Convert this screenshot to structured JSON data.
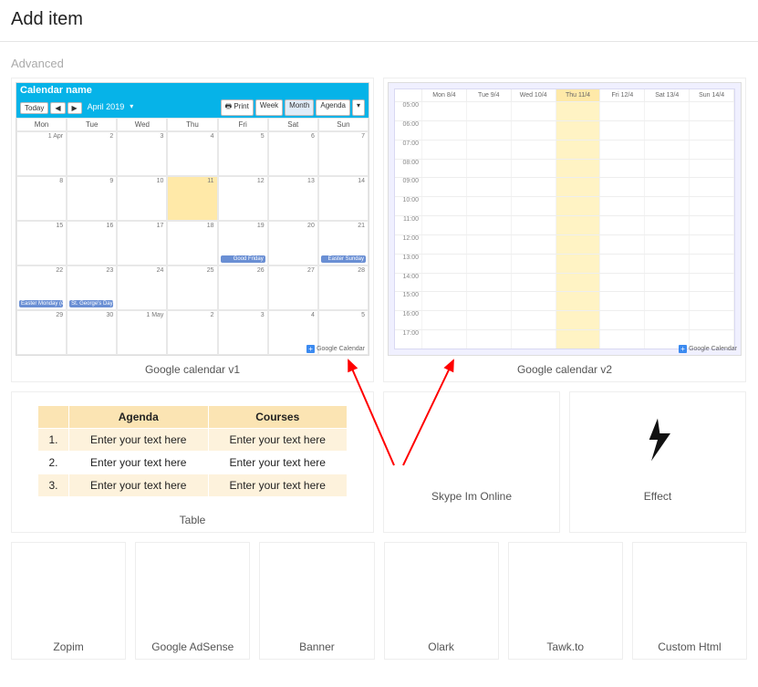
{
  "header": {
    "title": "Add item"
  },
  "section": "Advanced",
  "cal_v1": {
    "label": "Google calendar v1",
    "name": "Calendar name",
    "today": "Today",
    "month": "April 2019",
    "print": "Print",
    "views": [
      "Week",
      "Month",
      "Agenda"
    ],
    "days": [
      "Mon",
      "Tue",
      "Wed",
      "Thu",
      "Fri",
      "Sat",
      "Sun"
    ],
    "dates": [
      "1 Apr",
      "2",
      "3",
      "4",
      "5",
      "6",
      "7",
      "8",
      "9",
      "10",
      "11",
      "12",
      "13",
      "14",
      "15",
      "16",
      "17",
      "18",
      "19",
      "20",
      "21",
      "22",
      "23",
      "24",
      "25",
      "26",
      "27",
      "28",
      "29",
      "30",
      "1 May",
      "2",
      "3",
      "4",
      "5"
    ],
    "good_friday": "Good Friday",
    "easter_sunday": "Easter Sunday",
    "easter_monday": "Easter Monday (e",
    "st_george": "St. George's Day",
    "footer": "Google Calendar"
  },
  "cal_v2": {
    "label": "Google calendar v2",
    "days": [
      "Mon 8/4",
      "Tue 9/4",
      "Wed 10/4",
      "Thu 11/4",
      "Fri 12/4",
      "Sat 13/4",
      "Sun 14/4"
    ],
    "times": [
      "05:00",
      "06:00",
      "07:00",
      "08:00",
      "09:00",
      "10:00",
      "11:00",
      "12:00",
      "13:00",
      "14:00",
      "15:00",
      "16:00",
      "17:00"
    ],
    "footer": "Google Calendar"
  },
  "table": {
    "label": "Table",
    "headers": [
      "",
      "Agenda",
      "Courses"
    ],
    "rows": [
      [
        "1.",
        "Enter your text here",
        "Enter your text here"
      ],
      [
        "2.",
        "Enter your text here",
        "Enter your text here"
      ],
      [
        "3.",
        "Enter your text here",
        "Enter your text here"
      ]
    ]
  },
  "items": {
    "skype": "Skype Im Online",
    "effect": "Effect",
    "zopim": "Zopim",
    "adsense": "Google AdSense",
    "banner": "Banner",
    "olark": "Olark",
    "tawkto": "Tawk.to",
    "customhtml": "Custom Html"
  }
}
